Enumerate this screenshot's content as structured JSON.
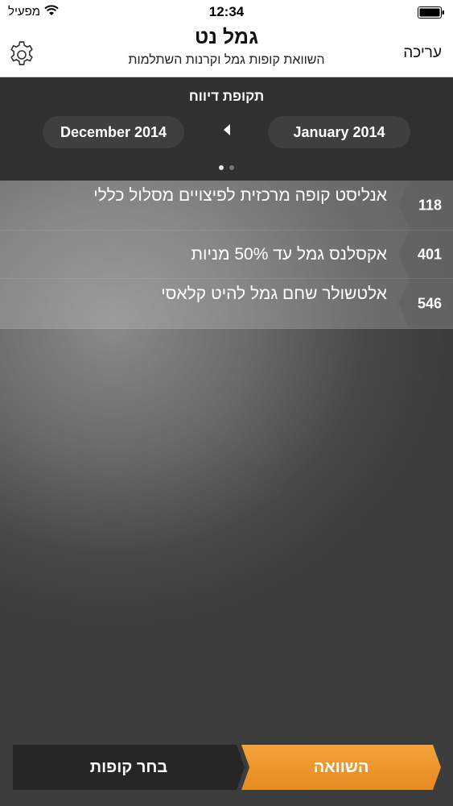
{
  "status_bar": {
    "carrier": "מפעיל",
    "time": "12:34",
    "wifi_icon": "wifi-icon",
    "battery_icon": "battery-icon"
  },
  "nav": {
    "title": "גמל נט",
    "subtitle": "השוואת קופות גמל וקרנות השתלמות",
    "edit_label": "עריכה",
    "settings_icon": "gear-icon"
  },
  "period": {
    "title": "תקופת דיווח",
    "start": "January 2014",
    "end": "December 2014",
    "page_count": 2,
    "current_page": 1
  },
  "funds": [
    {
      "id": "118",
      "name": "אנליסט קופה מרכזית לפיצויים מסלול כללי"
    },
    {
      "id": "401",
      "name": "אקסלנס גמל עד 50% מניות"
    },
    {
      "id": "546",
      "name": "אלטשולר שחם גמל להיט קלאסי"
    }
  ],
  "actions": {
    "select_funds_label": "בחר קופות",
    "compare_label": "השוואה"
  },
  "colors": {
    "accent_orange": "#ef9630",
    "panel_dark": "#303030",
    "button_dark": "#262626"
  }
}
